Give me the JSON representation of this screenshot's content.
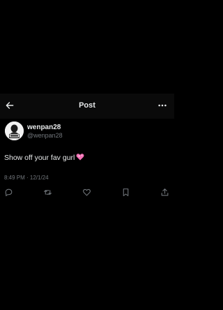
{
  "header": {
    "title": "Post",
    "back_icon": "arrow-left-icon",
    "more_icon": "more-horizontal-icon"
  },
  "author": {
    "display_name": "wenpan28",
    "handle": "@wenpan28"
  },
  "tweet": {
    "text": "Show off your fav gurl",
    "emoji": "sparkling-heart",
    "timestamp": "8:49 PM · 12/1/24"
  },
  "actions": [
    "reply-icon",
    "retweet-icon",
    "like-icon",
    "bookmark-icon",
    "share-icon"
  ],
  "colors": {
    "background": "#000000",
    "header_background": "#0a0a0a",
    "primary_text": "#e7e9ea",
    "secondary_text": "#71767b"
  }
}
